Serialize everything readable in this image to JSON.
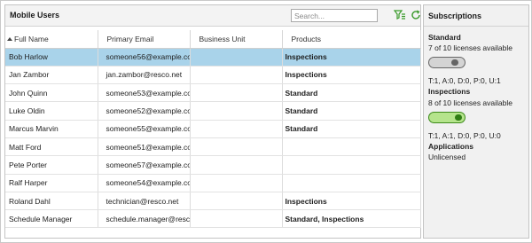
{
  "mobile_users": {
    "title": "Mobile Users",
    "search_placeholder": "Search...",
    "columns": [
      "Full Name",
      "Primary Email",
      "Business Unit",
      "Products"
    ],
    "rows": [
      {
        "name": "Bob Harlow",
        "email": "someone56@example.com",
        "bu": "",
        "products": "Inspections",
        "product_color": "green",
        "selected": true
      },
      {
        "name": "Jan Zambor",
        "email": "jan.zambor@resco.net",
        "bu": "",
        "products": "Inspections",
        "product_color": "green",
        "selected": false
      },
      {
        "name": "John Quinn",
        "email": "someone53@example.com",
        "bu": "",
        "products": "Standard",
        "product_color": "green",
        "selected": false
      },
      {
        "name": "Luke Oldin",
        "email": "someone52@example.com",
        "bu": "",
        "products": "Standard",
        "product_color": "green",
        "selected": false
      },
      {
        "name": "Marcus Marvin",
        "email": "someone55@example.com",
        "bu": "",
        "products": "Standard",
        "product_color": "green",
        "selected": false
      },
      {
        "name": "Matt Ford",
        "email": "someone51@example.com",
        "bu": "",
        "products": "",
        "product_color": "green",
        "selected": false
      },
      {
        "name": "Pete Porter",
        "email": "someone57@example.com",
        "bu": "",
        "products": "",
        "product_color": "green",
        "selected": false
      },
      {
        "name": "Ralf Harper",
        "email": "someone54@example.com",
        "bu": "",
        "products": "",
        "product_color": "green",
        "selected": false
      },
      {
        "name": "Roland Dahl",
        "email": "technician@resco.net",
        "bu": "",
        "products": "Inspections",
        "product_color": "orange",
        "selected": false
      },
      {
        "name": "Schedule Manager",
        "email": "schedule.manager@resco.net",
        "bu": "",
        "products": "Standard, Inspections",
        "product_color": "orange",
        "selected": false
      }
    ]
  },
  "subscriptions": {
    "title": "Subscriptions",
    "items": [
      {
        "name": "Standard",
        "availability": "7 of 10 licenses available",
        "toggle": "off",
        "stats": "T:1, A:0, D:0, P:0, U:1"
      },
      {
        "name": "Inspections",
        "availability": "8 of 10 licenses available",
        "toggle": "on",
        "stats": "T:1, A:1, D:0, P:0, U:0"
      },
      {
        "name": "Applications",
        "availability": "Unlicensed"
      }
    ]
  },
  "colors": {
    "selected_row": "#a9d3ea",
    "product_green": "#4a8a23",
    "product_orange": "#c0651a",
    "toggle_on": "#b5e48c"
  },
  "icons": [
    "filter-icon",
    "refresh-icon",
    "sort-ascending-icon",
    "toggle-switch"
  ]
}
